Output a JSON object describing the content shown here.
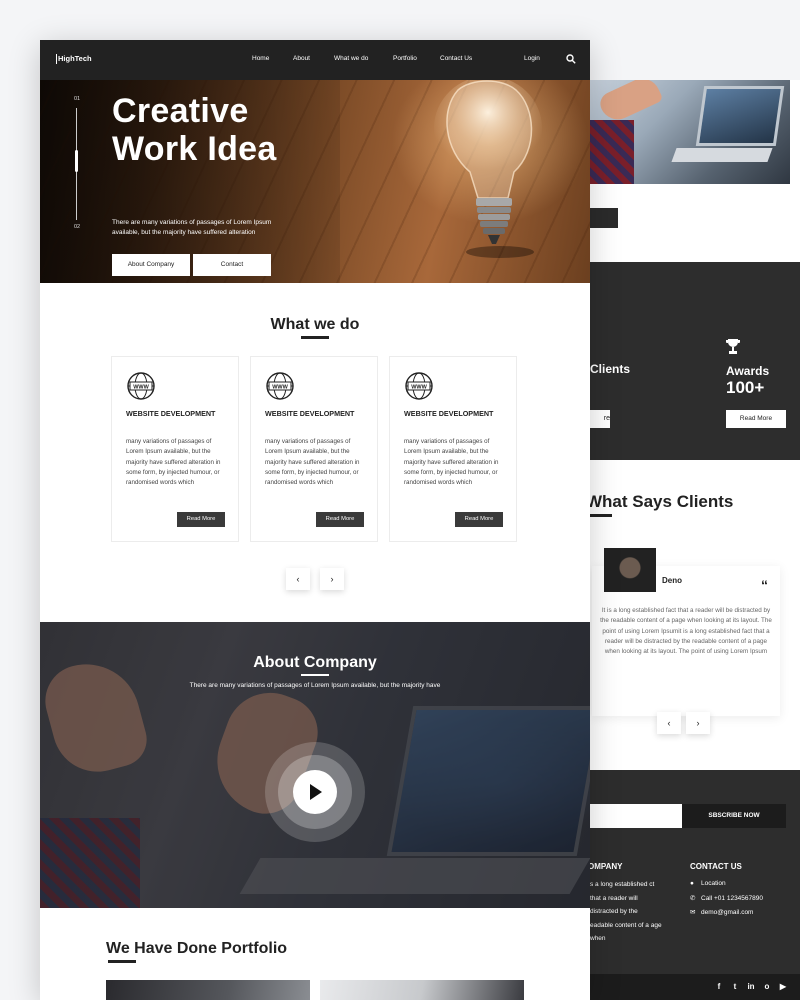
{
  "back": {
    "stats": {
      "clients_label": "Clients",
      "clients_btn": "re",
      "awards_label": "Awards",
      "awards_value": "100+",
      "awards_btn": "Read More"
    },
    "testimonials": {
      "title": "What Says Clients",
      "name": "Deno",
      "quote_mark": "“",
      "text": "It is a long established fact that a reader will be distracted by the readable content of a page when looking at its layout. The point of using Lorem Ipsumit is a long established fact that a reader will be distracted by the readable content of a page when looking at its layout. The point of using Lorem Ipsum",
      "prev": "‹",
      "next": "›"
    },
    "footer": {
      "subscribe_btn": "SBSCRIBE NOW",
      "company_title": "OMPANY",
      "company_text": "s a long established ct that a reader will distracted by the eadable content of a age when",
      "contact_title": "CONTACT US",
      "location": "Location",
      "phone": "Call +01 1234567890",
      "email": "demo@gmail.com"
    },
    "social": [
      "f",
      "t",
      "in",
      "o",
      "▶"
    ]
  },
  "nav": {
    "logo": "HighTech",
    "items": [
      "Home",
      "About",
      "What we do",
      "Portfolio",
      "Contact Us"
    ],
    "login": "Login"
  },
  "hero": {
    "slide_start": "01",
    "slide_end": "02",
    "title_line1": "Creative",
    "title_line2": "Work Idea",
    "subtitle": "There are many variations of passages of Lorem Ipsum available, but the majority have suffered alteration",
    "btn_about": "About Company",
    "btn_contact": "Contact"
  },
  "what_we_do": {
    "title": "What we do",
    "cards": [
      {
        "title": "WEBSITE DEVELOPMENT",
        "text": "many variations of passages of Lorem Ipsum available, but the majority have suffered alteration in some form, by injected humour, or randomised words which",
        "button": "Read More"
      },
      {
        "title": "WEBSITE DEVELOPMENT",
        "text": "many variations of passages of Lorem Ipsum available, but the majority have suffered alteration in some form, by injected humour, or randomised words which",
        "button": "Read More"
      },
      {
        "title": "WEBSITE DEVELOPMENT",
        "text": "many variations of passages of Lorem Ipsum available, but the majority have suffered alteration in some form, by injected humour, or randomised words which",
        "button": "Read More"
      }
    ],
    "prev": "‹",
    "next": "›"
  },
  "about": {
    "title": "About Company",
    "subtitle": "There are many variations of passages of Lorem Ipsum available, but the majority have"
  },
  "portfolio": {
    "title": "We Have Done Portfolio"
  }
}
